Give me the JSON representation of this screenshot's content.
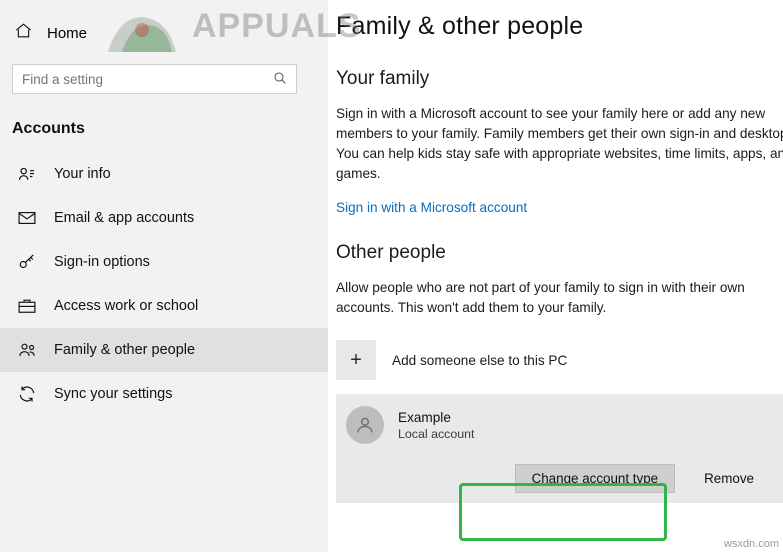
{
  "window": {
    "watermark_brand": "APPUALS",
    "watermark_corner": "wsxdn.com"
  },
  "sidebar": {
    "home_label": "Home",
    "home_icon": "home-icon",
    "search": {
      "placeholder": "Find a setting",
      "value": "",
      "icon": "search-icon"
    },
    "group_title": "Accounts",
    "items": [
      {
        "label": "Your info",
        "icon": "account-info-icon",
        "selected": false
      },
      {
        "label": "Email & app accounts",
        "icon": "mail-icon",
        "selected": false
      },
      {
        "label": "Sign-in options",
        "icon": "key-icon",
        "selected": false
      },
      {
        "label": "Access work or school",
        "icon": "briefcase-icon",
        "selected": false
      },
      {
        "label": "Family & other people",
        "icon": "people-icon",
        "selected": true
      },
      {
        "label": "Sync your settings",
        "icon": "sync-icon",
        "selected": false
      }
    ]
  },
  "main": {
    "page_title": "Family & other people",
    "family": {
      "heading": "Your family",
      "description": "Sign in with a Microsoft account to see your family here or add any new members to your family. Family members get their own sign-in and desktop. You can help kids stay safe with appropriate websites, time limits, apps, and games.",
      "link": "Sign in with a Microsoft account",
      "link_color": "#0a6cbc"
    },
    "other_people": {
      "heading": "Other people",
      "description": "Allow people who are not part of your family to sign in with their own accounts. This won't add them to your family.",
      "add_label": "Add someone else to this PC",
      "add_icon": "plus-icon",
      "account": {
        "avatar_icon": "user-avatar-icon",
        "name": "Example",
        "type": "Local account",
        "change_button": "Change account type",
        "remove_button": "Remove"
      },
      "highlight_color": "#33b44a"
    }
  }
}
